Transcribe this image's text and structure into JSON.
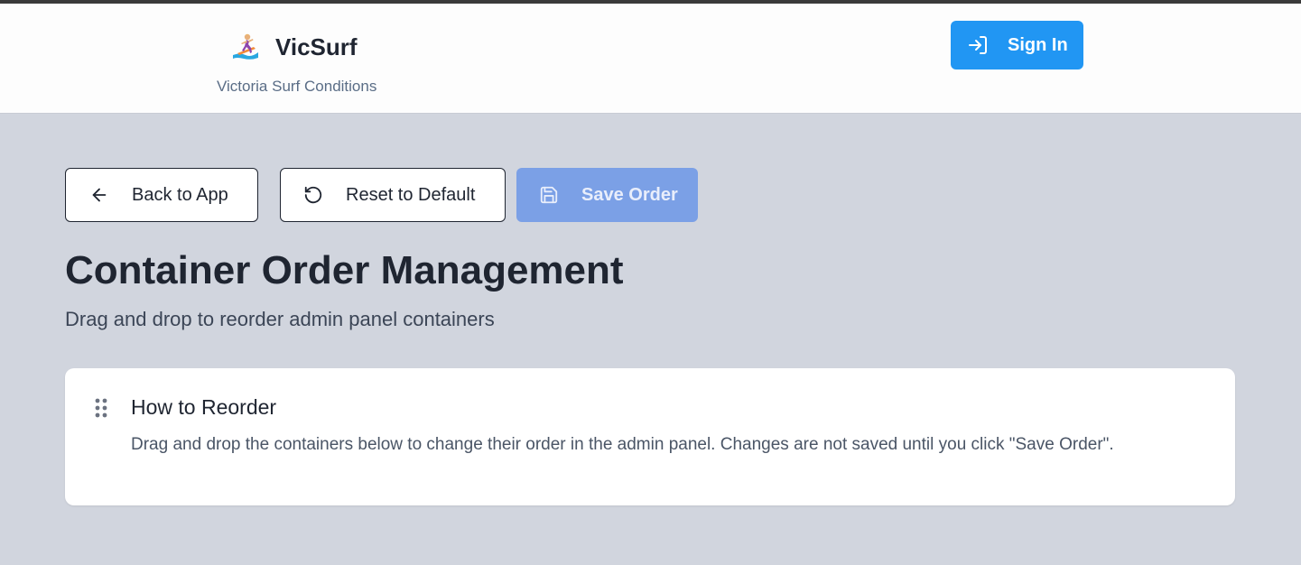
{
  "header": {
    "brand_name": "VicSurf",
    "brand_subtitle": "Victoria Surf Conditions",
    "brand_icon": "surfer-icon",
    "signin_label": "Sign In",
    "signin_icon": "sign-in-icon",
    "accent_color": "#2196f3"
  },
  "toolbar": {
    "back_label": "Back to App",
    "back_icon": "arrow-left-icon",
    "reset_label": "Reset to Default",
    "reset_icon": "reset-icon",
    "save_label": "Save Order",
    "save_icon": "save-icon",
    "save_disabled": true
  },
  "page": {
    "title": "Container Order Management",
    "subtitle": "Drag and drop to reorder admin panel containers"
  },
  "info_card": {
    "title": "How to Reorder",
    "body": "Drag and drop the containers below to change their order in the admin panel. Changes are not saved until you click \"Save Order\".",
    "handle_icon": "drag-handle-icon"
  }
}
